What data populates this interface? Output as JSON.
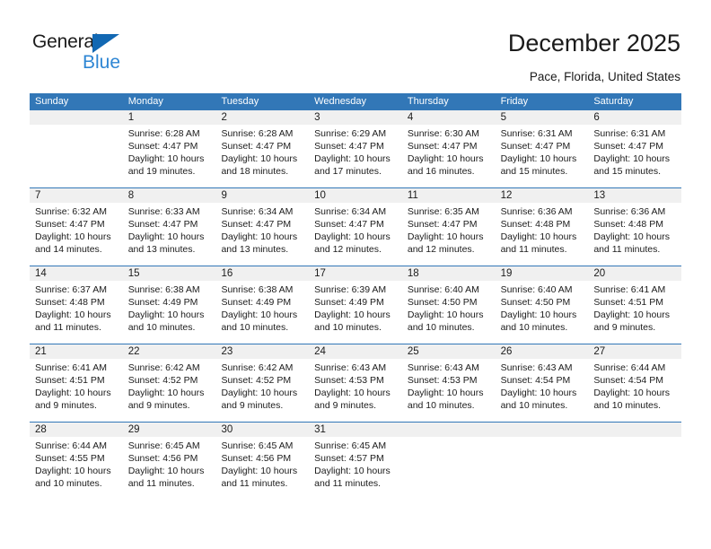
{
  "brand": {
    "name_part1": "General",
    "name_part2": "Blue",
    "triangle_icon": "triangle-icon",
    "accent_color": "#1268b3",
    "blue_text_color": "#2e86d4"
  },
  "header": {
    "title": "December 2025",
    "subtitle": "Pace, Florida, United States"
  },
  "calendar": {
    "header_bg": "#3277b7",
    "number_band_bg": "#f0f0f0",
    "weekdays": [
      "Sunday",
      "Monday",
      "Tuesday",
      "Wednesday",
      "Thursday",
      "Friday",
      "Saturday"
    ],
    "weeks": [
      [
        {
          "day": "",
          "sunrise": "",
          "sunset": "",
          "daylight1": "",
          "daylight2": ""
        },
        {
          "day": "1",
          "sunrise": "Sunrise: 6:28 AM",
          "sunset": "Sunset: 4:47 PM",
          "daylight1": "Daylight: 10 hours",
          "daylight2": "and 19 minutes."
        },
        {
          "day": "2",
          "sunrise": "Sunrise: 6:28 AM",
          "sunset": "Sunset: 4:47 PM",
          "daylight1": "Daylight: 10 hours",
          "daylight2": "and 18 minutes."
        },
        {
          "day": "3",
          "sunrise": "Sunrise: 6:29 AM",
          "sunset": "Sunset: 4:47 PM",
          "daylight1": "Daylight: 10 hours",
          "daylight2": "and 17 minutes."
        },
        {
          "day": "4",
          "sunrise": "Sunrise: 6:30 AM",
          "sunset": "Sunset: 4:47 PM",
          "daylight1": "Daylight: 10 hours",
          "daylight2": "and 16 minutes."
        },
        {
          "day": "5",
          "sunrise": "Sunrise: 6:31 AM",
          "sunset": "Sunset: 4:47 PM",
          "daylight1": "Daylight: 10 hours",
          "daylight2": "and 15 minutes."
        },
        {
          "day": "6",
          "sunrise": "Sunrise: 6:31 AM",
          "sunset": "Sunset: 4:47 PM",
          "daylight1": "Daylight: 10 hours",
          "daylight2": "and 15 minutes."
        }
      ],
      [
        {
          "day": "7",
          "sunrise": "Sunrise: 6:32 AM",
          "sunset": "Sunset: 4:47 PM",
          "daylight1": "Daylight: 10 hours",
          "daylight2": "and 14 minutes."
        },
        {
          "day": "8",
          "sunrise": "Sunrise: 6:33 AM",
          "sunset": "Sunset: 4:47 PM",
          "daylight1": "Daylight: 10 hours",
          "daylight2": "and 13 minutes."
        },
        {
          "day": "9",
          "sunrise": "Sunrise: 6:34 AM",
          "sunset": "Sunset: 4:47 PM",
          "daylight1": "Daylight: 10 hours",
          "daylight2": "and 13 minutes."
        },
        {
          "day": "10",
          "sunrise": "Sunrise: 6:34 AM",
          "sunset": "Sunset: 4:47 PM",
          "daylight1": "Daylight: 10 hours",
          "daylight2": "and 12 minutes."
        },
        {
          "day": "11",
          "sunrise": "Sunrise: 6:35 AM",
          "sunset": "Sunset: 4:47 PM",
          "daylight1": "Daylight: 10 hours",
          "daylight2": "and 12 minutes."
        },
        {
          "day": "12",
          "sunrise": "Sunrise: 6:36 AM",
          "sunset": "Sunset: 4:48 PM",
          "daylight1": "Daylight: 10 hours",
          "daylight2": "and 11 minutes."
        },
        {
          "day": "13",
          "sunrise": "Sunrise: 6:36 AM",
          "sunset": "Sunset: 4:48 PM",
          "daylight1": "Daylight: 10 hours",
          "daylight2": "and 11 minutes."
        }
      ],
      [
        {
          "day": "14",
          "sunrise": "Sunrise: 6:37 AM",
          "sunset": "Sunset: 4:48 PM",
          "daylight1": "Daylight: 10 hours",
          "daylight2": "and 11 minutes."
        },
        {
          "day": "15",
          "sunrise": "Sunrise: 6:38 AM",
          "sunset": "Sunset: 4:49 PM",
          "daylight1": "Daylight: 10 hours",
          "daylight2": "and 10 minutes."
        },
        {
          "day": "16",
          "sunrise": "Sunrise: 6:38 AM",
          "sunset": "Sunset: 4:49 PM",
          "daylight1": "Daylight: 10 hours",
          "daylight2": "and 10 minutes."
        },
        {
          "day": "17",
          "sunrise": "Sunrise: 6:39 AM",
          "sunset": "Sunset: 4:49 PM",
          "daylight1": "Daylight: 10 hours",
          "daylight2": "and 10 minutes."
        },
        {
          "day": "18",
          "sunrise": "Sunrise: 6:40 AM",
          "sunset": "Sunset: 4:50 PM",
          "daylight1": "Daylight: 10 hours",
          "daylight2": "and 10 minutes."
        },
        {
          "day": "19",
          "sunrise": "Sunrise: 6:40 AM",
          "sunset": "Sunset: 4:50 PM",
          "daylight1": "Daylight: 10 hours",
          "daylight2": "and 10 minutes."
        },
        {
          "day": "20",
          "sunrise": "Sunrise: 6:41 AM",
          "sunset": "Sunset: 4:51 PM",
          "daylight1": "Daylight: 10 hours",
          "daylight2": "and 9 minutes."
        }
      ],
      [
        {
          "day": "21",
          "sunrise": "Sunrise: 6:41 AM",
          "sunset": "Sunset: 4:51 PM",
          "daylight1": "Daylight: 10 hours",
          "daylight2": "and 9 minutes."
        },
        {
          "day": "22",
          "sunrise": "Sunrise: 6:42 AM",
          "sunset": "Sunset: 4:52 PM",
          "daylight1": "Daylight: 10 hours",
          "daylight2": "and 9 minutes."
        },
        {
          "day": "23",
          "sunrise": "Sunrise: 6:42 AM",
          "sunset": "Sunset: 4:52 PM",
          "daylight1": "Daylight: 10 hours",
          "daylight2": "and 9 minutes."
        },
        {
          "day": "24",
          "sunrise": "Sunrise: 6:43 AM",
          "sunset": "Sunset: 4:53 PM",
          "daylight1": "Daylight: 10 hours",
          "daylight2": "and 9 minutes."
        },
        {
          "day": "25",
          "sunrise": "Sunrise: 6:43 AM",
          "sunset": "Sunset: 4:53 PM",
          "daylight1": "Daylight: 10 hours",
          "daylight2": "and 10 minutes."
        },
        {
          "day": "26",
          "sunrise": "Sunrise: 6:43 AM",
          "sunset": "Sunset: 4:54 PM",
          "daylight1": "Daylight: 10 hours",
          "daylight2": "and 10 minutes."
        },
        {
          "day": "27",
          "sunrise": "Sunrise: 6:44 AM",
          "sunset": "Sunset: 4:54 PM",
          "daylight1": "Daylight: 10 hours",
          "daylight2": "and 10 minutes."
        }
      ],
      [
        {
          "day": "28",
          "sunrise": "Sunrise: 6:44 AM",
          "sunset": "Sunset: 4:55 PM",
          "daylight1": "Daylight: 10 hours",
          "daylight2": "and 10 minutes."
        },
        {
          "day": "29",
          "sunrise": "Sunrise: 6:45 AM",
          "sunset": "Sunset: 4:56 PM",
          "daylight1": "Daylight: 10 hours",
          "daylight2": "and 11 minutes."
        },
        {
          "day": "30",
          "sunrise": "Sunrise: 6:45 AM",
          "sunset": "Sunset: 4:56 PM",
          "daylight1": "Daylight: 10 hours",
          "daylight2": "and 11 minutes."
        },
        {
          "day": "31",
          "sunrise": "Sunrise: 6:45 AM",
          "sunset": "Sunset: 4:57 PM",
          "daylight1": "Daylight: 10 hours",
          "daylight2": "and 11 minutes."
        },
        {
          "day": "",
          "sunrise": "",
          "sunset": "",
          "daylight1": "",
          "daylight2": ""
        },
        {
          "day": "",
          "sunrise": "",
          "sunset": "",
          "daylight1": "",
          "daylight2": ""
        },
        {
          "day": "",
          "sunrise": "",
          "sunset": "",
          "daylight1": "",
          "daylight2": ""
        }
      ]
    ]
  }
}
